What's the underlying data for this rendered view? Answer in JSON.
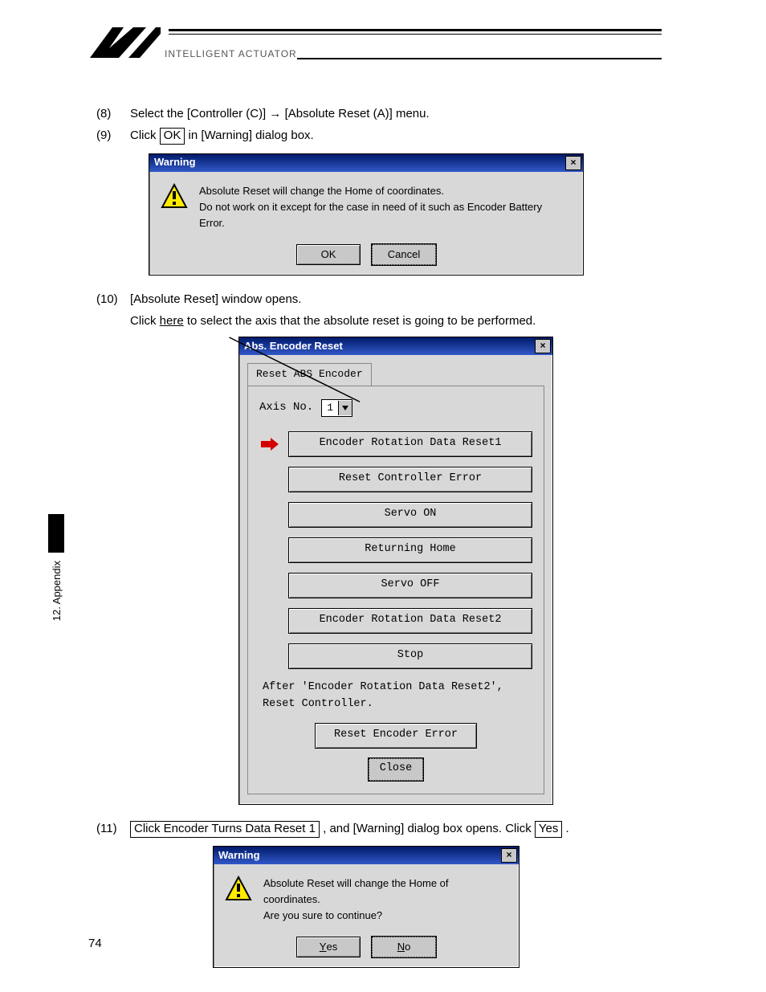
{
  "header": {
    "brand": "INTELLIGENT ACTUATOR"
  },
  "steps": {
    "s8": {
      "num": "(8)",
      "pre": "Select the [Controller (C)] ",
      "arrow": "→",
      "post": " [Absolute Reset (A)] menu."
    },
    "s9": {
      "num": "(9)",
      "pre": "Click ",
      "boxed": "OK",
      "post": " in [Warning] dialog box."
    },
    "s10": {
      "num": "(10)",
      "text": "[Absolute Reset] window opens.",
      "sub_pre": "Click ",
      "sub_here": "here",
      "sub_post": " to select the axis that the absolute reset is going to be performed."
    },
    "s11": {
      "num": "(11)",
      "boxed1": "Click Encoder Turns Data Reset 1",
      "mid": ", and [Warning] dialog box opens. Click ",
      "boxed2": "Yes",
      "end": "."
    }
  },
  "dialog1": {
    "title": "Warning",
    "line1": "Absolute Reset will change the Home of coordinates.",
    "line2": "Do not work on it except for the case in need of it such as Encoder Battery Error.",
    "ok": "OK",
    "cancel": "Cancel"
  },
  "encoder": {
    "title": "Abs. Encoder Reset",
    "tab": "Reset ABS Encoder",
    "axis_label": "Axis No.",
    "axis_value": "1",
    "btn1": "Encoder Rotation Data Reset1",
    "btn2": "Reset Controller Error",
    "btn3": "Servo ON",
    "btn4": "Returning Home",
    "btn5": "Servo OFF",
    "btn6": "Encoder Rotation Data Reset2",
    "btn7": "Stop",
    "note1": "After 'Encoder Rotation Data Reset2',",
    "note2": "Reset Controller.",
    "btn8": "Reset Encoder Error",
    "close": "Close"
  },
  "dialog2": {
    "title": "Warning",
    "line1": "Absolute Reset will change the Home of coordinates.",
    "line2": "Are you sure to continue?",
    "yes": "Yes",
    "no": "No"
  },
  "side": {
    "label": "12. Appendix",
    "page": "74"
  }
}
